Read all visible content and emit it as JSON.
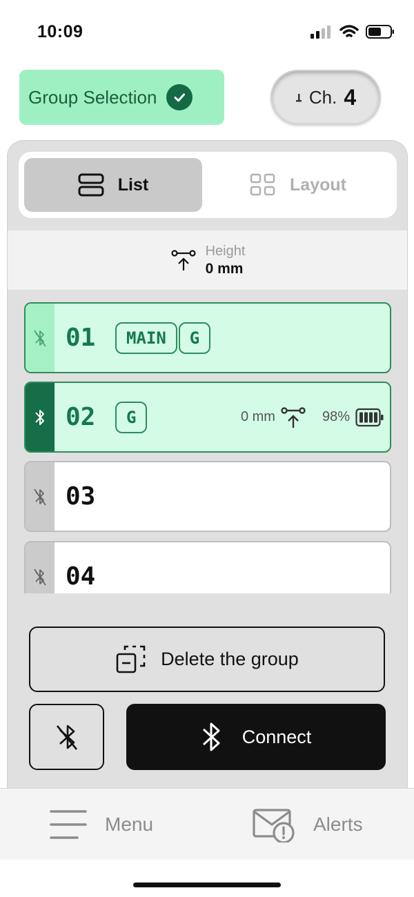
{
  "status": {
    "time": "10:09"
  },
  "header": {
    "group_selection_label": "Group Selection",
    "channel_label": "Ch.",
    "channel_number": "4"
  },
  "view_toggle": {
    "list_label": "List",
    "layout_label": "Layout",
    "selected": "List"
  },
  "height": {
    "label": "Height",
    "value": "0 mm"
  },
  "devices": [
    {
      "number": "01",
      "tags": [
        "MAIN",
        "G"
      ],
      "selected": true,
      "bluetooth": "disabled"
    },
    {
      "number": "02",
      "tags": [
        "G"
      ],
      "selected": true,
      "bluetooth": "connected",
      "height": "0 mm",
      "battery": "98%",
      "battery_level": 0.98
    },
    {
      "number": "03",
      "tags": [],
      "selected": false,
      "bluetooth": "disabled"
    },
    {
      "number": "04",
      "tags": [],
      "selected": false,
      "bluetooth": "disabled"
    }
  ],
  "actions": {
    "delete_group_label": "Delete the group",
    "connect_label": "Connect"
  },
  "tabbar": {
    "menu_label": "Menu",
    "alerts_label": "Alerts"
  },
  "colors": {
    "accent_green": "#14794b",
    "selection_bg": "#d3fbe6",
    "header_green": "#9ef0c2",
    "dark": "#111111"
  }
}
